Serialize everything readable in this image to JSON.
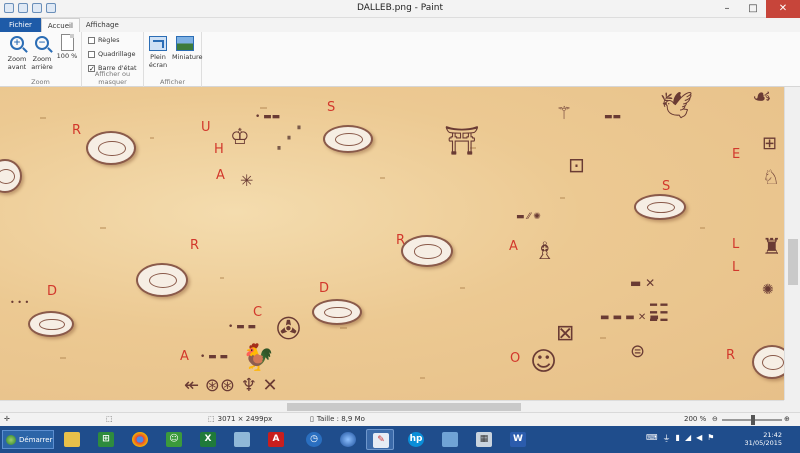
{
  "window": {
    "title": "DALLEB.png - Paint"
  },
  "tabs": [
    "Fichier",
    "Accueil",
    "Affichage"
  ],
  "ribbon": {
    "zoom_in": "Zoom avant",
    "zoom_out": "Zoom arrière",
    "zoom_100": "100 %",
    "zoom_group": "Zoom",
    "rulers": "Règles",
    "gridlines": "Quadrillage",
    "statusbar": "Barre d'état",
    "show_group": "Afficher ou masquer",
    "fullscreen": "Plein écran",
    "thumbnail": "Miniature",
    "display_group": "Afficher"
  },
  "canvas": {
    "letters": [
      "R",
      "U",
      "H",
      "A",
      "S",
      "R",
      "R",
      "A",
      "S",
      "E",
      "L",
      "L",
      "D",
      "C",
      "D",
      "A",
      "O",
      "R"
    ]
  },
  "status": {
    "dimensions": "3071 × 2499px",
    "size": "Taille : 8,9 Mo",
    "zoom": "200 %"
  },
  "taskbar": {
    "start": "Démarrer",
    "time": "21:42",
    "date": "31/05/2015"
  }
}
